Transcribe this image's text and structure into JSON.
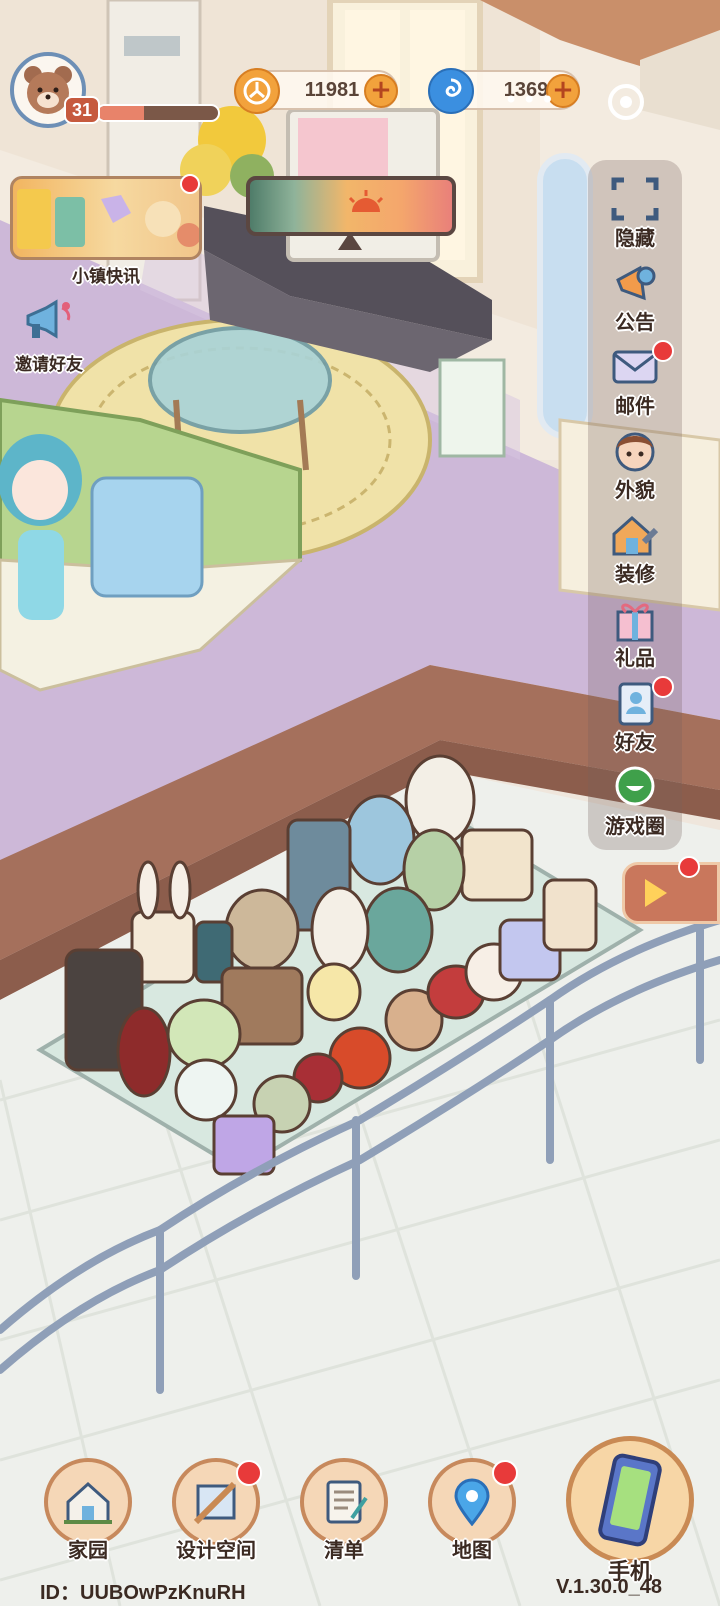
{
  "player": {
    "level": "31",
    "xp_progress": 0.38,
    "avatar_icon": "bear-avatar-icon"
  },
  "currencies": [
    {
      "name": "coin",
      "icon": "coin-icon",
      "value": "11981",
      "color": "#f2a23c"
    },
    {
      "name": "crystal",
      "icon": "swirl-gem-icon",
      "value": "1369",
      "color": "#3b8fe0"
    }
  ],
  "top_controls": {
    "menu_dots": "•••",
    "target_icon": "target-icon"
  },
  "left_widgets": {
    "news": {
      "label": "小镇快讯",
      "icon": "town-news-banner"
    },
    "invite": {
      "label": "邀请好友",
      "icon": "megaphone-icon"
    }
  },
  "side_menu": [
    {
      "id": "hide",
      "label": "隐藏",
      "icon": "hide-frame-icon",
      "badge": false
    },
    {
      "id": "notice",
      "label": "公告",
      "icon": "announcement-icon",
      "badge": false
    },
    {
      "id": "mail",
      "label": "邮件",
      "icon": "mail-icon",
      "badge": true
    },
    {
      "id": "appearance",
      "label": "外貌",
      "icon": "character-face-icon",
      "badge": false
    },
    {
      "id": "decorate",
      "label": "装修",
      "icon": "house-wrench-icon",
      "badge": false
    },
    {
      "id": "gift",
      "label": "礼品",
      "icon": "gift-box-icon",
      "badge": false
    },
    {
      "id": "friends",
      "label": "好友",
      "icon": "contact-book-icon",
      "badge": true
    },
    {
      "id": "circle",
      "label": "游戏圈",
      "icon": "chat-bubble-icon",
      "badge": false
    }
  ],
  "bottom_nav": [
    {
      "id": "home",
      "label": "家园",
      "icon": "house-icon",
      "badge": false
    },
    {
      "id": "design",
      "label": "设计空间",
      "icon": "design-ruler-icon",
      "badge": true
    },
    {
      "id": "list",
      "label": "清单",
      "icon": "checklist-icon",
      "badge": false
    },
    {
      "id": "map",
      "label": "地图",
      "icon": "map-pin-icon",
      "badge": true
    }
  ],
  "phone": {
    "label": "手机",
    "icon": "phone-icon"
  },
  "footer": {
    "id_text": "ID：UUBOwPzKnuRH",
    "version": "V.1.30.0_48"
  },
  "colors": {
    "floor": "#cdb8d8",
    "wall_cream": "#f5ece0",
    "accent_red": "#e83a3a",
    "rail": "#8f9fb8"
  }
}
